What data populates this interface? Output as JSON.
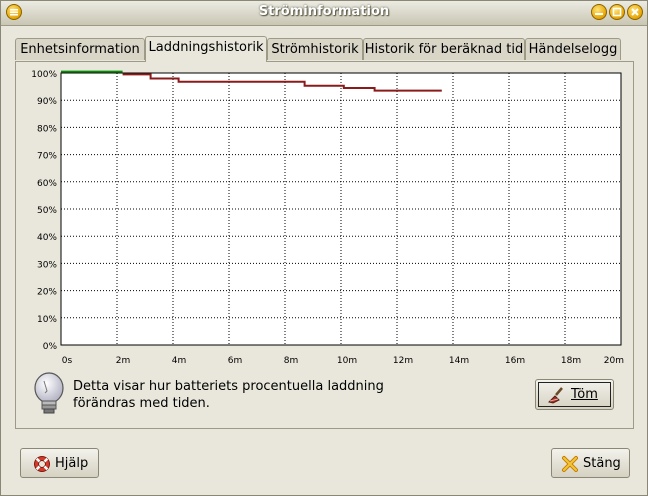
{
  "window": {
    "title": "Ströminformation"
  },
  "tabs": [
    {
      "label": "Enhetsinformation",
      "active": false
    },
    {
      "label": "Laddningshistorik",
      "active": true
    },
    {
      "label": "Strömhistorik",
      "active": false
    },
    {
      "label": "Historik för beräknad tid",
      "active": false
    },
    {
      "label": "Händelselogg",
      "active": false
    }
  ],
  "info_text_line1": "Detta visar hur batteriets procentuella laddning",
  "info_text_line2": "förändras med tiden.",
  "buttons": {
    "clear": "Töm",
    "help": "Hjälp",
    "close": "Stäng"
  },
  "chart_data": {
    "type": "line",
    "x_ticks": [
      "0s",
      "2m",
      "4m",
      "6m",
      "8m",
      "10m",
      "12m",
      "14m",
      "16m",
      "18m",
      "20m"
    ],
    "y_ticks": [
      "100%",
      "90%",
      "80%",
      "70%",
      "60%",
      "50%",
      "40%",
      "30%",
      "20%",
      "10%",
      "0%"
    ],
    "xlim_minutes": [
      0,
      20
    ],
    "ylim": [
      0,
      100
    ],
    "grid": true,
    "series": [
      {
        "color": "#0a8a0a",
        "points": [
          [
            0,
            100.5
          ],
          [
            2.2,
            100.5
          ]
        ]
      },
      {
        "color": "#8b1a1a",
        "points": [
          [
            2.2,
            99.5
          ],
          [
            3.2,
            99.5
          ],
          [
            3.2,
            98
          ],
          [
            4.2,
            98
          ],
          [
            4.2,
            96.8
          ],
          [
            8.7,
            96.8
          ],
          [
            8.7,
            95.3
          ],
          [
            10.1,
            95.3
          ],
          [
            10.1,
            94.5
          ],
          [
            11.2,
            94.5
          ],
          [
            11.2,
            93.5
          ],
          [
            13.6,
            93.5
          ]
        ]
      }
    ]
  }
}
